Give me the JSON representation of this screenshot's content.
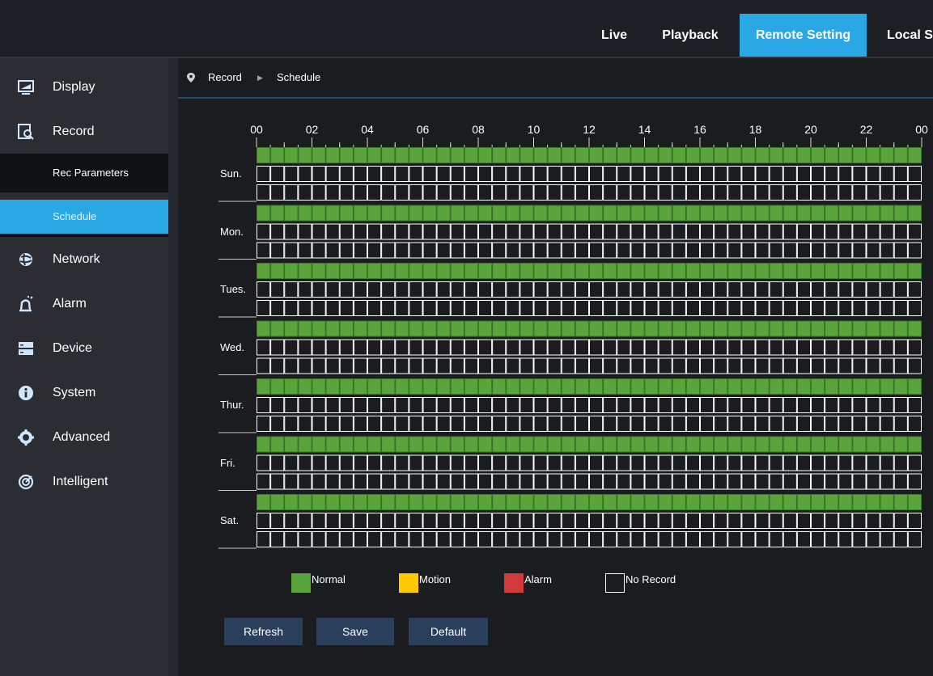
{
  "topnav": {
    "items": [
      {
        "label": "Live",
        "active": false
      },
      {
        "label": "Playback",
        "active": false
      },
      {
        "label": "Remote Setting",
        "active": true
      },
      {
        "label": "Local S",
        "active": false
      }
    ]
  },
  "sidebar": {
    "items": [
      {
        "label": "Display",
        "icon": "monitor-icon"
      },
      {
        "label": "Record",
        "icon": "record-search-icon"
      },
      {
        "label": "Network",
        "icon": "network-globe-icon"
      },
      {
        "label": "Alarm",
        "icon": "alarm-siren-icon"
      },
      {
        "label": "Device",
        "icon": "device-storage-icon"
      },
      {
        "label": "System",
        "icon": "info-icon"
      },
      {
        "label": "Advanced",
        "icon": "gear-icon"
      },
      {
        "label": "Intelligent",
        "icon": "intelligent-icon"
      }
    ],
    "record_subitems": [
      {
        "label": "Rec Parameters",
        "active": false
      },
      {
        "label": "Schedule",
        "active": true
      }
    ]
  },
  "breadcrumb": {
    "section": "Record",
    "page": "Schedule"
  },
  "schedule": {
    "hour_labels": [
      "00",
      "02",
      "04",
      "06",
      "08",
      "10",
      "12",
      "14",
      "16",
      "18",
      "20",
      "22",
      "00"
    ],
    "days": [
      {
        "label": "Sun.",
        "rows": [
          "normal",
          "none",
          "none"
        ]
      },
      {
        "label": "Mon.",
        "rows": [
          "normal",
          "none",
          "none"
        ]
      },
      {
        "label": "Tues.",
        "rows": [
          "normal",
          "none",
          "none"
        ]
      },
      {
        "label": "Wed.",
        "rows": [
          "normal",
          "none",
          "none"
        ]
      },
      {
        "label": "Thur.",
        "rows": [
          "normal",
          "none",
          "none"
        ]
      },
      {
        "label": "Fri.",
        "rows": [
          "normal",
          "none",
          "none"
        ]
      },
      {
        "label": "Sat.",
        "rows": [
          "normal",
          "none",
          "none"
        ]
      }
    ],
    "slots_per_day": 48
  },
  "legend": [
    {
      "label": "Normal",
      "color": "#5aa43c"
    },
    {
      "label": "Motion",
      "color": "#ffc800"
    },
    {
      "label": "Alarm",
      "color": "#d03a3a"
    },
    {
      "label": "No Record",
      "color": "#1b1c20"
    }
  ],
  "buttons": {
    "refresh": "Refresh",
    "save": "Save",
    "default": "Default"
  },
  "colors": {
    "accent": "#2aa8e6",
    "normal": "#5aa43c",
    "button": "#2a3f5c"
  }
}
